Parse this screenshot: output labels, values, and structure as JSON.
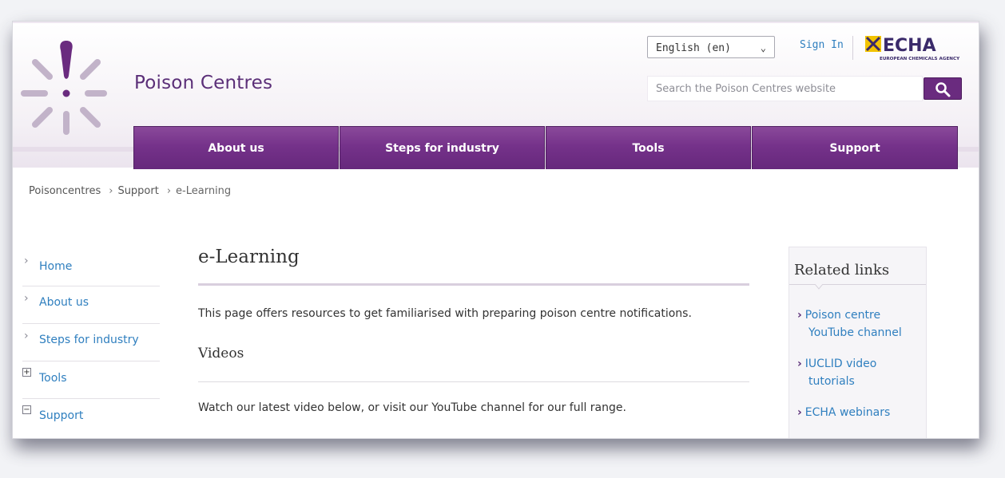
{
  "header": {
    "site_title": "Poison Centres",
    "language": "English (en)",
    "sign_in": "Sign In",
    "echa_logo_text": "ECHA",
    "echa_logo_sub": "EUROPEAN CHEMICALS AGENCY",
    "search_placeholder": "Search the Poison Centres website"
  },
  "nav": {
    "tabs": [
      {
        "label": "About us"
      },
      {
        "label": "Steps for industry"
      },
      {
        "label": "Tools"
      },
      {
        "label": "Support"
      }
    ]
  },
  "breadcrumb": [
    "Poisoncentres",
    "Support",
    "e-Learning"
  ],
  "sidebar": {
    "items": [
      {
        "label": "Home",
        "icon": "chevron-right-icon"
      },
      {
        "label": "About us",
        "icon": "chevron-right-icon"
      },
      {
        "label": "Steps for industry",
        "icon": "chevron-right-icon"
      },
      {
        "label": "Tools",
        "icon": "expand-icon",
        "toggle": "+"
      },
      {
        "label": "Support",
        "icon": "collapse-icon",
        "toggle": "−"
      }
    ]
  },
  "main": {
    "title": "e-Learning",
    "intro": "This page offers resources to get familiarised with preparing poison centre notifications.",
    "videos_heading": "Videos",
    "videos_text": "Watch our latest video below, or visit our YouTube channel for our full range."
  },
  "related": {
    "title": "Related links",
    "links": [
      {
        "line1": "Poison centre",
        "line2": "YouTube channel"
      },
      {
        "line1": "IUCLID video",
        "line2": "tutorials"
      },
      {
        "line1": "ECHA webinars",
        "line2": ""
      }
    ]
  },
  "colors": {
    "brand_purple": "#6a2b7f",
    "link_blue": "#2f7fbf",
    "echa_yellow": "#f2c300"
  }
}
